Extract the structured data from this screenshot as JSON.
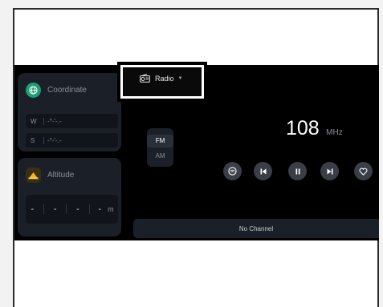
{
  "coordinate": {
    "title": "Coordinate",
    "rows": [
      {
        "label": "W",
        "value": "-°-'-.-"
      },
      {
        "label": "S",
        "value": "-°-'-.-"
      }
    ]
  },
  "altitude": {
    "title": "Altitude",
    "digits": [
      "-",
      "-",
      "-",
      "-"
    ],
    "unit": "m"
  },
  "source_selector": {
    "label": "Radio"
  },
  "band": {
    "fm": "FM",
    "am": "AM",
    "selected": "FM"
  },
  "frequency": {
    "value": "108",
    "unit": "MHz"
  },
  "controls": [
    "spotify-icon",
    "previous-icon",
    "pause-icon",
    "next-icon",
    "heart-icon"
  ],
  "channel": {
    "label": "No Channel"
  },
  "colors": {
    "coordinate_icon": "#1f9d74",
    "altitude_icon": "#f0b623",
    "card_bg": "#1b2028",
    "screen_bg": "#000000"
  }
}
